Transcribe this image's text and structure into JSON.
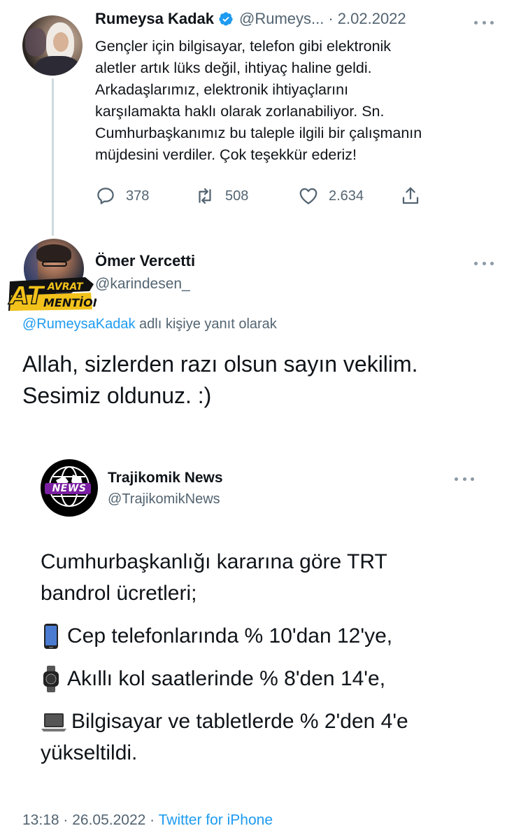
{
  "tweet": {
    "author_name": "Rumeysa Kadak",
    "author_handle": "@Rumeys...",
    "date": "· 2.02.2022",
    "lines": [
      "Gençler için bilgisayar, telefon gibi elektronik",
      "aletler artık lüks değil, ihtiyaç haline geldi.",
      "Arkadaşlarımız, elektronik ihtiyaçlarını",
      "karşılamakta haklı olarak zorlanabiliyor. Sn.",
      "Cumhurbaşkanımız bu taleple ilgili bir çalışmanın",
      "müjdesini verdiler. Çok teşekkür ederiz!"
    ],
    "reply_count": "378",
    "retweet_count": "508",
    "like_count": "2.634"
  },
  "reply": {
    "author_name": "Ömer Vercetti",
    "author_handle": "@karindesen_",
    "replying_to_handle": "@RumeysaKadak",
    "replying_to_suffix": " adlı kişiye yanıt olarak",
    "lines": [
      "Allah, sizlerden razı olsun sayın vekilim.",
      "Sesimiz oldunuz. :)"
    ],
    "watermark": {
      "line1_left": "AT",
      "line1_right": "AVRAT",
      "line2": "MENTİON"
    }
  },
  "quoted": {
    "author_name": "Trajikomik News",
    "author_handle": "@TrajikomikNews",
    "logo_text": "NEWS",
    "intro_lines": [
      "Cumhurbaşkanlığı kararına göre TRT",
      "bandrol ücretleri;"
    ],
    "items": [
      {
        "icon": "mobile-phone-icon",
        "text": "Cep telefonlarında % 10'dan 12'ye,"
      },
      {
        "icon": "smartwatch-icon",
        "text": "Akıllı kol saatlerinde % 8'den 14'e,"
      },
      {
        "icon": "laptop-icon",
        "text": "Bilgisayar ve tabletlerde % 2'den 4'e"
      }
    ],
    "tail": "yükseltildi."
  },
  "footer": {
    "time_date": "13:18 · 26.05.2022 · ",
    "source": "Twitter for iPhone"
  },
  "colors": {
    "accent": "#1d9bf0",
    "secondary_text": "#536471",
    "primary_text": "#0f1419"
  }
}
